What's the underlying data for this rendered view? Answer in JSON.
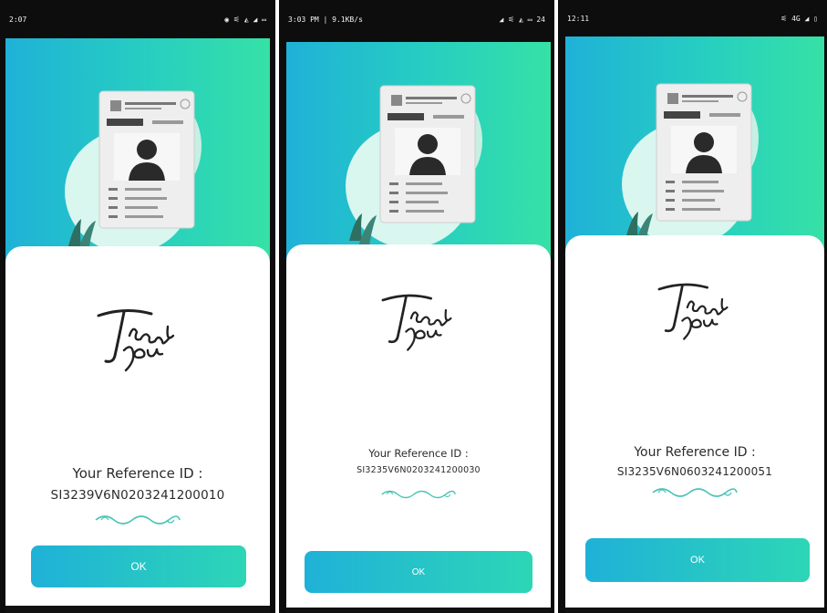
{
  "screens": [
    {
      "status_time": "2:07",
      "status_right": "◉ ⚟ ◭ ◢ ▭",
      "reference_label": "Your Reference ID :",
      "reference_id": "SI3239V6N0203241200010",
      "button_label": "OK"
    },
    {
      "status_time": "3:03 PM | 9.1KB/s",
      "status_right": "◢ ⚟ ◭ ▭ 24",
      "reference_label": "Your Reference ID :",
      "reference_id": "SI3235V6N0203241200030",
      "button_label": "OK"
    },
    {
      "status_time": "12:11",
      "status_right": "⚟ 4G ◢ ▯",
      "reference_label": "Your Reference ID :",
      "reference_id": "SI3235V6N0603241200051",
      "button_label": "OK"
    }
  ],
  "thank_you_text": "Thank you",
  "colors": {
    "gradient_start": "#1fb1d8",
    "gradient_end": "#36e1a6",
    "card_bg": "#ffffff",
    "flourish": "#4cc4b6"
  },
  "icons": {
    "voter_id_card": "id-card-illustration",
    "thank_you": "thank-you-script",
    "divider": "flourish-divider"
  }
}
